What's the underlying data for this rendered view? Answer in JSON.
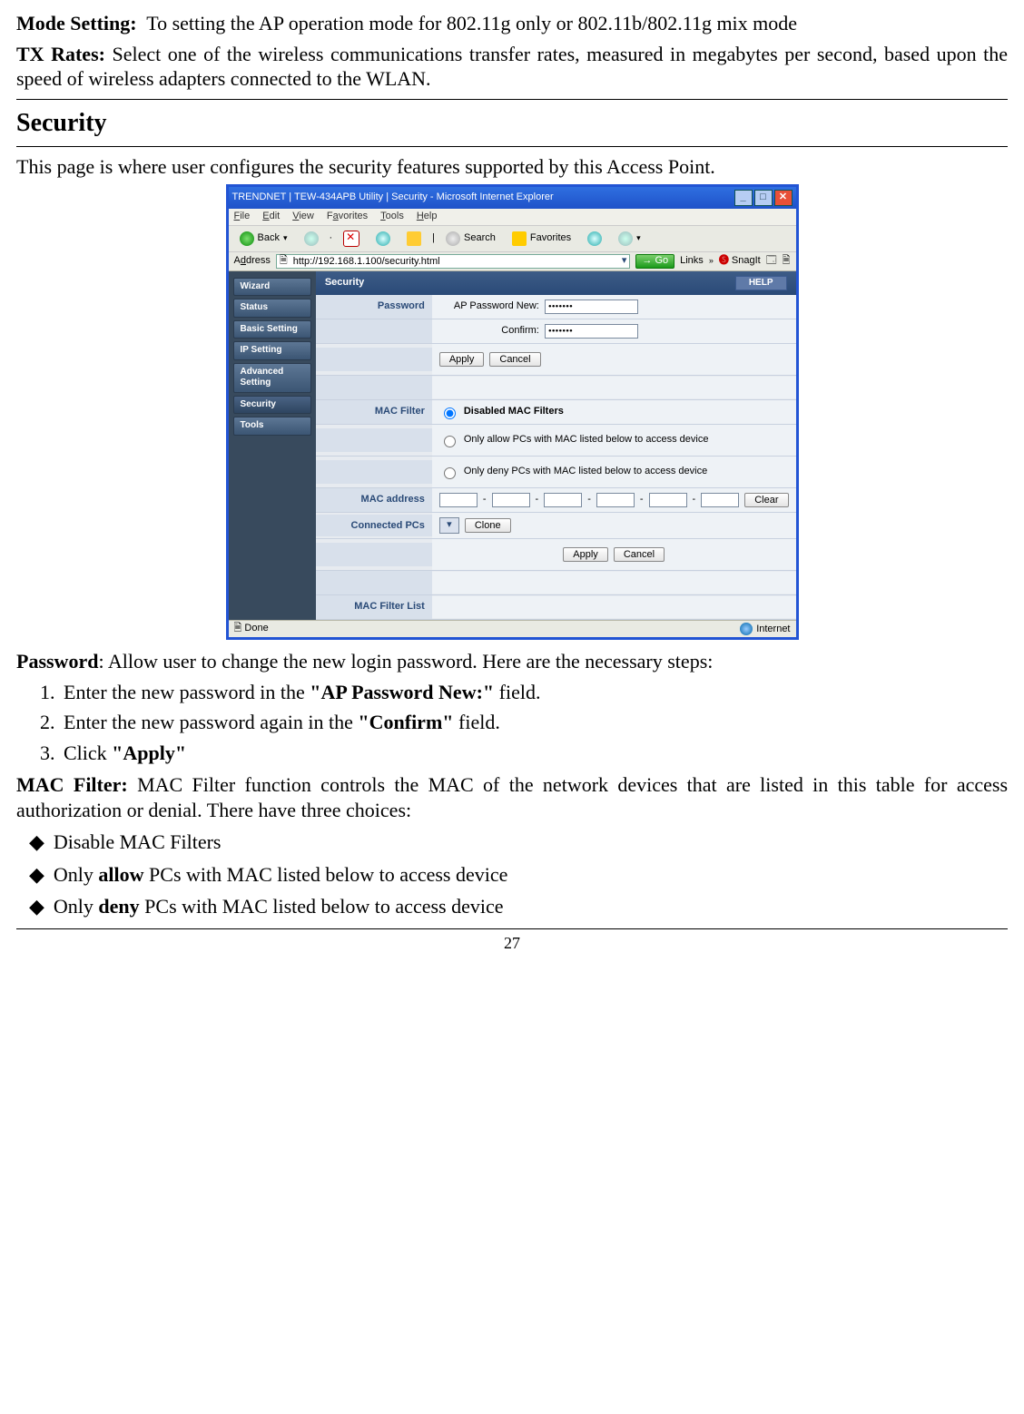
{
  "paragraphs": {
    "mode_label": "Mode  Setting:",
    "mode_text": "To  setting  the  AP  operation  mode  for  802.11g  only  or 802.11b/802.11g mix mode",
    "tx_label": "TX Rates:",
    "tx_text": "Select one of the wireless communications transfer rates, measured in megabytes per second, based upon the speed of wireless adapters connected to the WLAN.",
    "security_title": "Security",
    "security_intro": "This page is where user configures the security features supported by this Access Point.",
    "password_label": "Password",
    "password_text": ": Allow user to change the new login password. Here are the necessary steps:",
    "step1_pre": "Enter the new password in the ",
    "step1_bold": "\"AP Password New:\"",
    "step1_post": " field.",
    "step2_pre": "Enter the new password again in the ",
    "step2_bold": "\"Confirm\"",
    "step2_post": " field.",
    "step3_pre": "Click ",
    "step3_bold": "\"Apply\"",
    "mac_label": "MAC Filter:",
    "mac_text": " MAC Filter function controls the MAC of the network devices that are listed in this table for access authorization or denial. There have three choices:",
    "bullet1": "Disable MAC Filters",
    "bullet2_pre": "Only ",
    "bullet2_b": "allow",
    "bullet2_post": " PCs with MAC listed below to access device",
    "bullet3_pre": "Only ",
    "bullet3_b": "deny",
    "bullet3_post": " PCs with MAC listed below to access device"
  },
  "browser": {
    "title": "TRENDNET | TEW-434APB Utility | Security - Microsoft Internet Explorer",
    "menu": {
      "file": "File",
      "edit": "Edit",
      "view": "View",
      "favorites": "Favorites",
      "tools": "Tools",
      "help": "Help"
    },
    "toolbar": {
      "back": "Back",
      "search": "Search",
      "favorites": "Favorites"
    },
    "addr_label": "Address",
    "url": "http://192.168.1.100/security.html",
    "go": "Go",
    "links": "Links",
    "snagit": "SnagIt",
    "status": "Done",
    "zone": "Internet"
  },
  "sidebar": [
    "Wizard",
    "Status",
    "Basic Setting",
    "IP Setting",
    "Advanced Setting",
    "Security",
    "Tools"
  ],
  "content": {
    "title": "Security",
    "help": "HELP",
    "pw_label": "Password",
    "pw_new": "AP Password New:",
    "pw_confirm": "Confirm:",
    "pw_mask": "•••••••",
    "apply": "Apply",
    "cancel": "Cancel",
    "mac_filter": "MAC Filter",
    "opt_disabled": "Disabled MAC Filters",
    "opt_allow": "Only allow PCs with MAC listed below to access device",
    "opt_deny": "Only deny PCs with MAC listed below to access device",
    "mac_addr": "MAC address",
    "clear": "Clear",
    "connected": "Connected PCs",
    "clone": "Clone",
    "list": "MAC Filter List"
  },
  "page_number": "27"
}
